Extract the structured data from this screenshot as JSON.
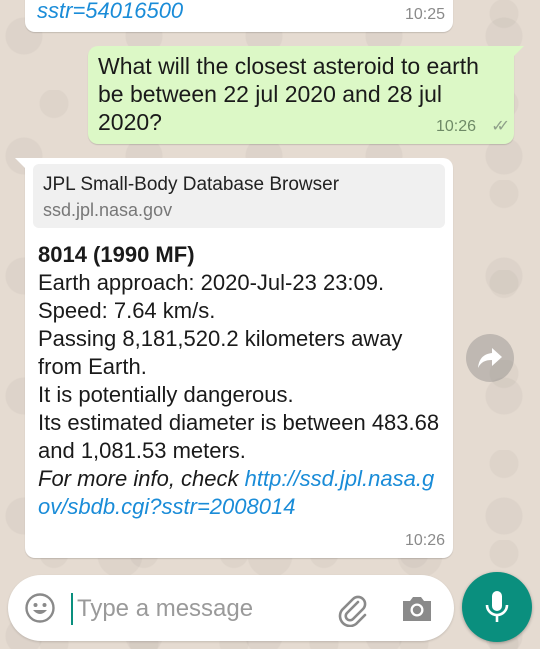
{
  "messages": [
    {
      "link_tail": "sstr=54016500",
      "time": "10:25"
    },
    {
      "text": "What will the closest asteroid to earth be between 22 jul 2020 and 28 jul 2020?",
      "time": "10:26",
      "ticks": "✓✓"
    },
    {
      "preview_title": "JPL Small-Body Database Browser",
      "preview_domain": "ssd.jpl.nasa.gov",
      "heading": "8014 (1990 MF)",
      "lines": [
        "Earth approach: 2020-Jul-23 23:09.",
        "Speed: 7.64 km/s.",
        "Passing 8,181,520.2 kilometers away from Earth.",
        "It is potentially dangerous.",
        "Its estimated diameter is between 483.68 and 1,081.53 meters."
      ],
      "more_info_label": "For more info, check ",
      "link": "http://ssd.jpl.nasa.gov/sbdb.cgi?sstr=2008014",
      "time": "10:26"
    }
  ],
  "input": {
    "placeholder": "Type a message",
    "value": ""
  },
  "icons": {
    "emoji": "emoji-icon",
    "attach": "paperclip-icon",
    "camera": "camera-icon",
    "mic": "microphone-icon",
    "forward": "forward-icon"
  },
  "colors": {
    "accent": "#0a8f7e",
    "outgoing_bubble": "#dcf8c6",
    "link": "#1a8cd8"
  }
}
